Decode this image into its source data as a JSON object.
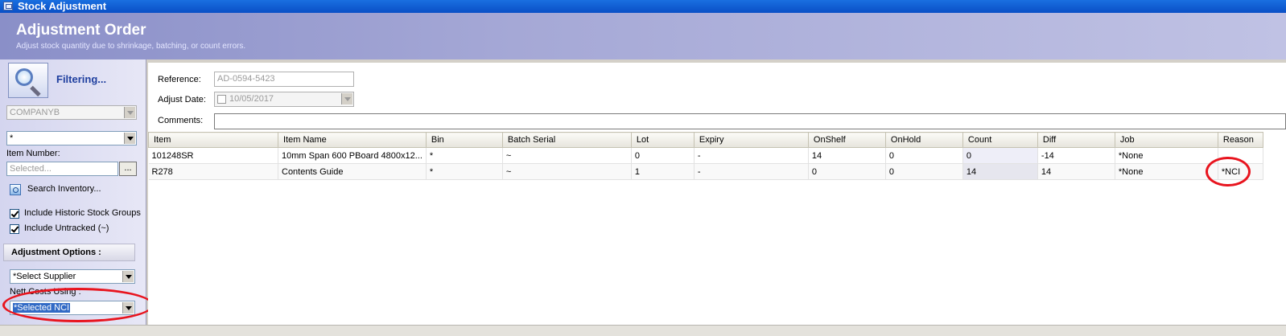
{
  "window": {
    "title": "Stock Adjustment"
  },
  "header": {
    "title": "Adjustment Order",
    "subtitle": "Adjust stock quantity due to shrinkage, batching, or count errors."
  },
  "sidebar": {
    "filter_label": "Filtering...",
    "company_value": "COMPANYB",
    "group_value": "*",
    "item_number_label": "Item Number:",
    "item_number_placeholder": "Selected...",
    "browse_label": "...",
    "search_inventory_label": "Search Inventory...",
    "include_historic_label": "Include Historic Stock Groups",
    "include_historic_checked": true,
    "include_untracked_label": "Include Untracked (~)",
    "include_untracked_checked": true,
    "adjustment_options_label": "Adjustment Options :",
    "supplier_value": "*Select Supplier",
    "nett_costs_label": "Nett Costs Using :",
    "nett_costs_value": "*Selected NCI"
  },
  "form": {
    "reference_label": "Reference:",
    "reference_value": "AD-0594-5423",
    "adjust_date_label": "Adjust Date:",
    "adjust_date_value": "10/05/2017",
    "comments_label": "Comments:",
    "comments_value": ""
  },
  "grid": {
    "columns": [
      "Item",
      "Item Name",
      "Bin",
      "Batch Serial",
      "Lot",
      "Expiry",
      "OnShelf",
      "OnHold",
      "Count",
      "Diff",
      "Job",
      "Reason"
    ],
    "rows": [
      [
        "101248SR",
        "10mm Span 600 PBoard 4800x12...",
        "*",
        "~",
        "0",
        "-",
        "14",
        "0",
        "0",
        "-14",
        "*None",
        ""
      ],
      [
        "R278",
        "Contents Guide",
        "*",
        "~",
        "1",
        "-",
        "0",
        "0",
        "14",
        "14",
        "*None",
        "*NCI"
      ]
    ]
  },
  "colors": {
    "titlebar": "#0a4fc6",
    "header_gradient_start": "#8a8fc8",
    "annotation_circle": "#e8141e",
    "selection": "#316ac5"
  }
}
